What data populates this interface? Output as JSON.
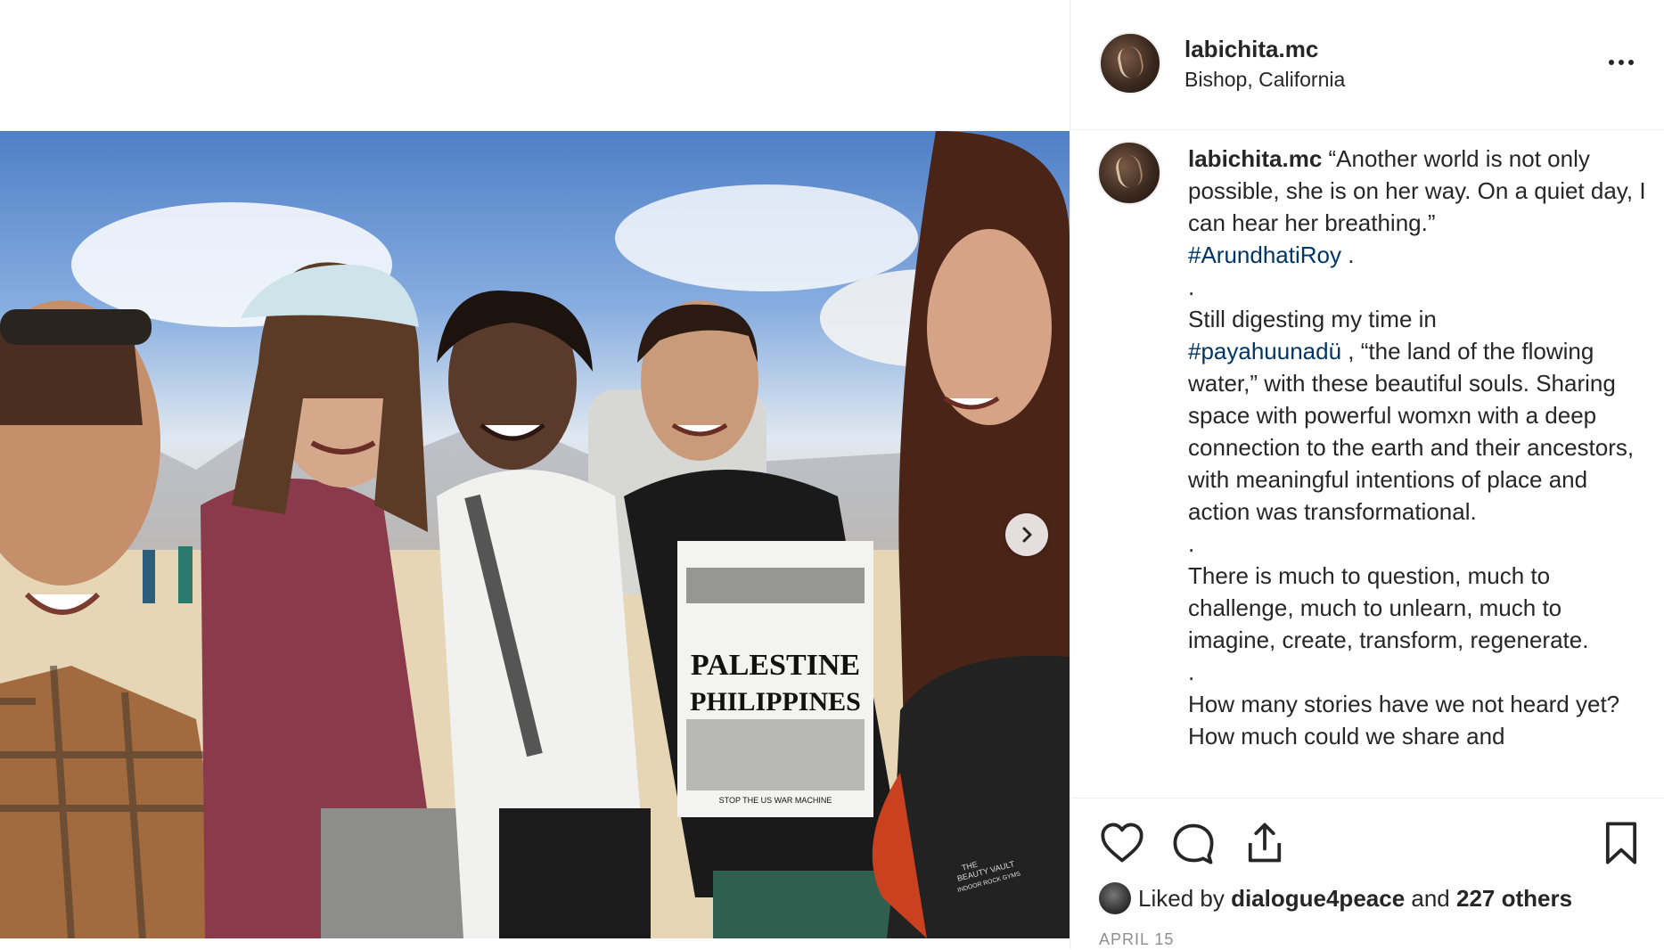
{
  "post": {
    "username": "labichita.mc",
    "location": "Bishop, California",
    "caption_username": "labichita.mc",
    "caption_parts": [
      {
        "text": " “Another world is not only possible, she is on her way. On a quiet day, I can hear her breathing.”\n"
      },
      {
        "text": "#ArundhatiRoy",
        "hashtag": true
      },
      {
        "text": " .\n.\nStill digesting my time in\n"
      },
      {
        "text": "#payahuunadü",
        "hashtag": true
      },
      {
        "text": " , “the land of the flowing water,” with these beautiful souls. Sharing space with powerful womxn with a deep connection to the earth and their ancestors, with meaningful intentions of place and action was transformational.\n.\nThere is much to question, much to challenge, much to unlearn, much to imagine, create, transform, regenerate.\n.\nHow many stories have we not heard yet? How much could we share and"
      }
    ],
    "likes": {
      "prefix": "Liked by ",
      "user": "dialogue4peace",
      "middle": " and ",
      "others": "227 others"
    },
    "date": "APRIL 15"
  },
  "photo": {
    "shirt_line1": "PALESTINE",
    "shirt_line2": "PHILIPPINES",
    "shirt_line3": "STOP THE US WAR MACHINE",
    "bag_text_1": "THE",
    "bag_text_2": "BEAUTY VAULT",
    "bag_text_3": "INDOOR ROCK GYMS"
  },
  "icons": {
    "more": "more-options-icon",
    "next": "chevron-right-icon",
    "like": "heart-icon",
    "comment": "comment-icon",
    "share": "share-icon",
    "save": "bookmark-icon"
  },
  "colors": {
    "text": "#262626",
    "hashtag": "#003569",
    "muted": "#8e8e8e",
    "border": "#efefef"
  }
}
